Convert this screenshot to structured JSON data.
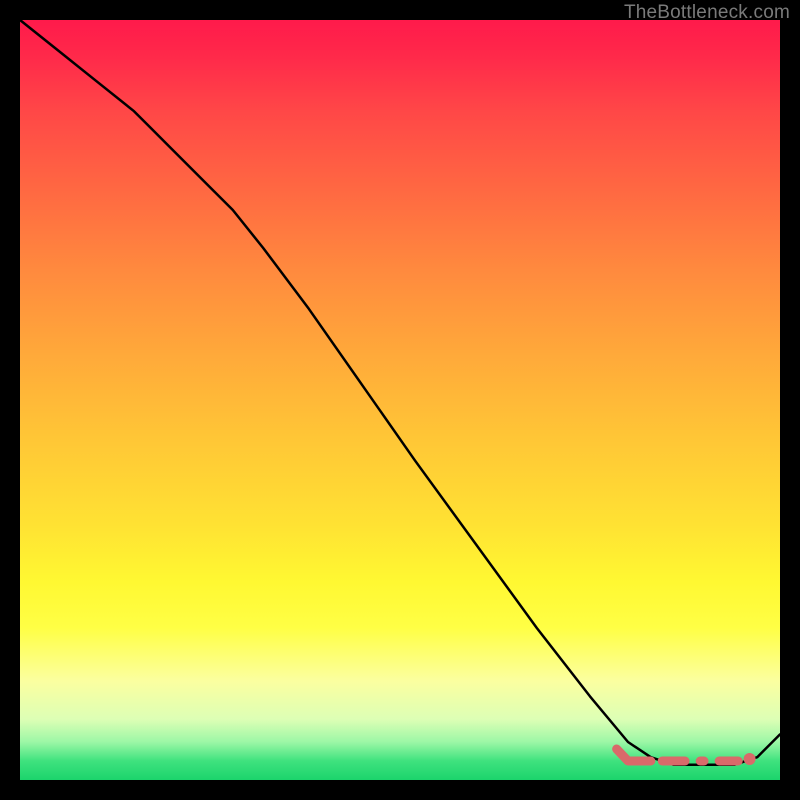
{
  "watermark": "TheBottleneck.com",
  "marker_color": "#d96a6a",
  "chart_data": {
    "type": "line",
    "title": "",
    "xlabel": "",
    "ylabel": "",
    "xlim": [
      0,
      100
    ],
    "ylim": [
      0,
      100
    ],
    "series": [
      {
        "name": "bottleneck-curve",
        "x": [
          0,
          5,
          10,
          15,
          20,
          25,
          28,
          32,
          38,
          45,
          52,
          60,
          68,
          75,
          80,
          83,
          86,
          90,
          94,
          97,
          100
        ],
        "y": [
          100,
          96,
          92,
          88,
          83,
          78,
          75,
          70,
          62,
          52,
          42,
          31,
          20,
          11,
          5,
          3,
          2,
          2,
          2,
          3,
          6
        ]
      }
    ],
    "highlight_band": {
      "x_start": 80,
      "x_end": 96,
      "y": 2.5
    }
  }
}
